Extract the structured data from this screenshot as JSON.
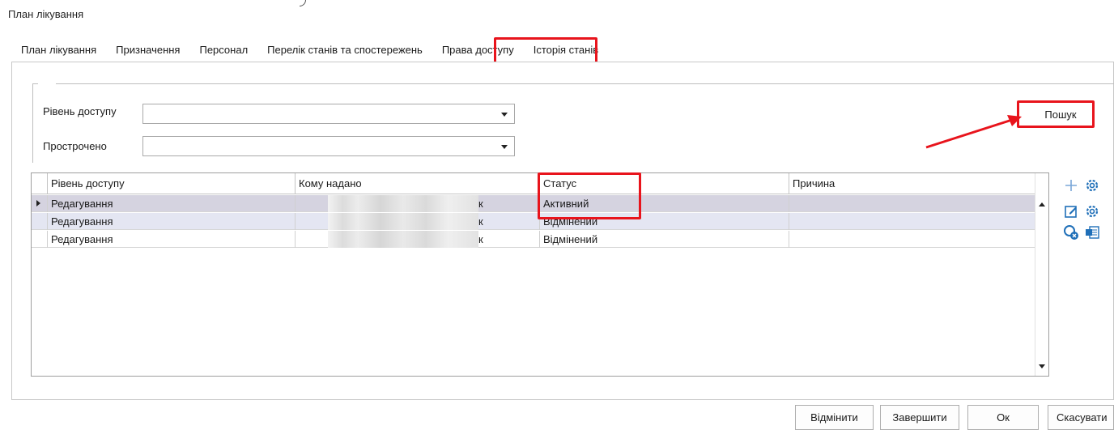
{
  "window": {
    "title": "План лікування"
  },
  "tabs": [
    {
      "label": "План лікування"
    },
    {
      "label": "Призначення"
    },
    {
      "label": "Персонал"
    },
    {
      "label": "Перелік станів та спостережень"
    },
    {
      "label": "Права доступу",
      "active": true
    },
    {
      "label": "Історія станів"
    }
  ],
  "filters": {
    "access_level_label": "Рівень доступу",
    "access_level_value": "",
    "expired_label": "Прострочено",
    "expired_value": "",
    "search_label": "Пошук"
  },
  "grid": {
    "columns": [
      "Рівень доступу",
      "Кому надано",
      "Статус",
      "Причина"
    ],
    "rows": [
      {
        "access_level": "Редагування",
        "granted_to_suffix": "к",
        "status": "Активний",
        "reason": ""
      },
      {
        "access_level": "Редагування",
        "granted_to_suffix": "к",
        "status": "Відмінений",
        "reason": ""
      },
      {
        "access_level": "Редагування",
        "granted_to_suffix": "к",
        "status": "Відмінений",
        "reason": ""
      }
    ]
  },
  "side_toolbar": {
    "icons": [
      "add-icon",
      "settings-icon",
      "edit-icon",
      "settings-icon",
      "cancel-access-icon",
      "export-icon"
    ]
  },
  "buttons": {
    "revoke": "Відмінити",
    "finish": "Завершити",
    "ok": "Ок",
    "cancel": "Скасувати"
  },
  "colors": {
    "highlight": "#e8141c",
    "selected_row": "#d5d3e0",
    "alt_row": "#e4e6f2",
    "icon_blue": "#1f6fb8"
  }
}
